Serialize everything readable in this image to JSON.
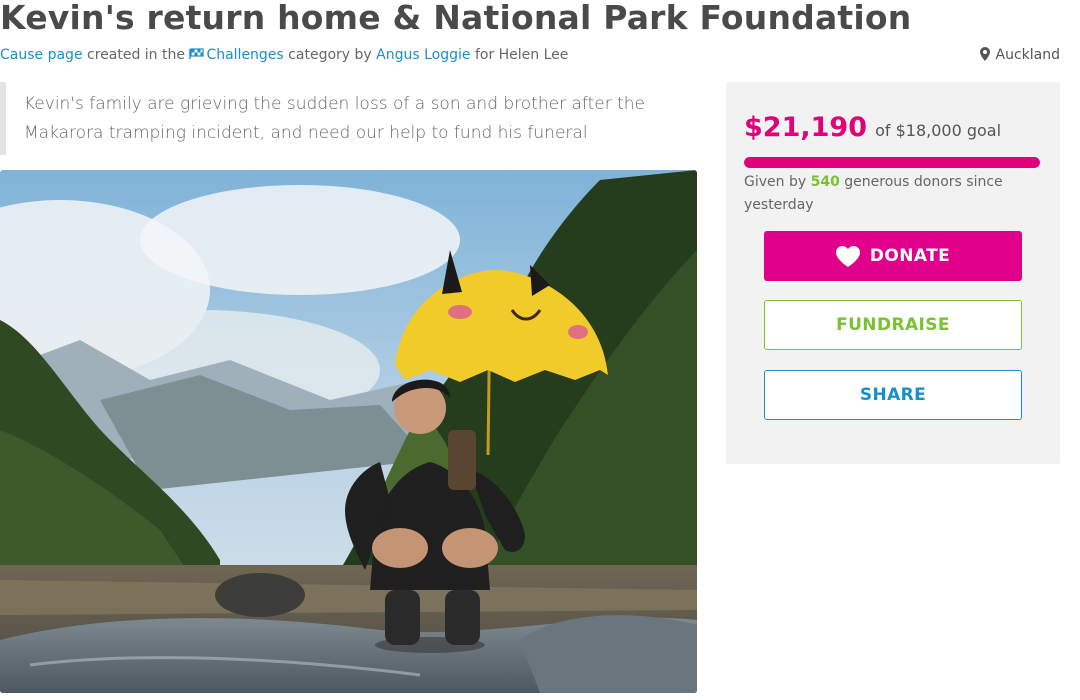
{
  "page": {
    "title": "Kevin's return home & National Park Foundation",
    "meta": {
      "prefix": "Cause page",
      "mid1": " created in the ",
      "category": "Challenges",
      "mid2": " category by ",
      "author": "Angus Loggie",
      "mid3": " for Helen Lee"
    },
    "location": "Auckland",
    "summary": "Kevin's family are grieving the sudden loss of a son and brother after the Makarora tramping incident, and need our help to fund his funeral"
  },
  "photo": {
    "icon": "photo-hero"
  },
  "donation": {
    "raised": "$21,190",
    "goal_text": "of $18,000 goal",
    "progress_fraction": 1.0,
    "given_prefix": "Given by ",
    "donor_count": "540",
    "given_suffix": " generous donors since yesterday"
  },
  "actions": {
    "donate_label": "DONATE",
    "fundraise_label": "FUNDRAISE",
    "share_label": "SHARE"
  },
  "colors": {
    "accent": "#e0007a",
    "green": "#7ac231",
    "link": "#1a8fc6"
  }
}
